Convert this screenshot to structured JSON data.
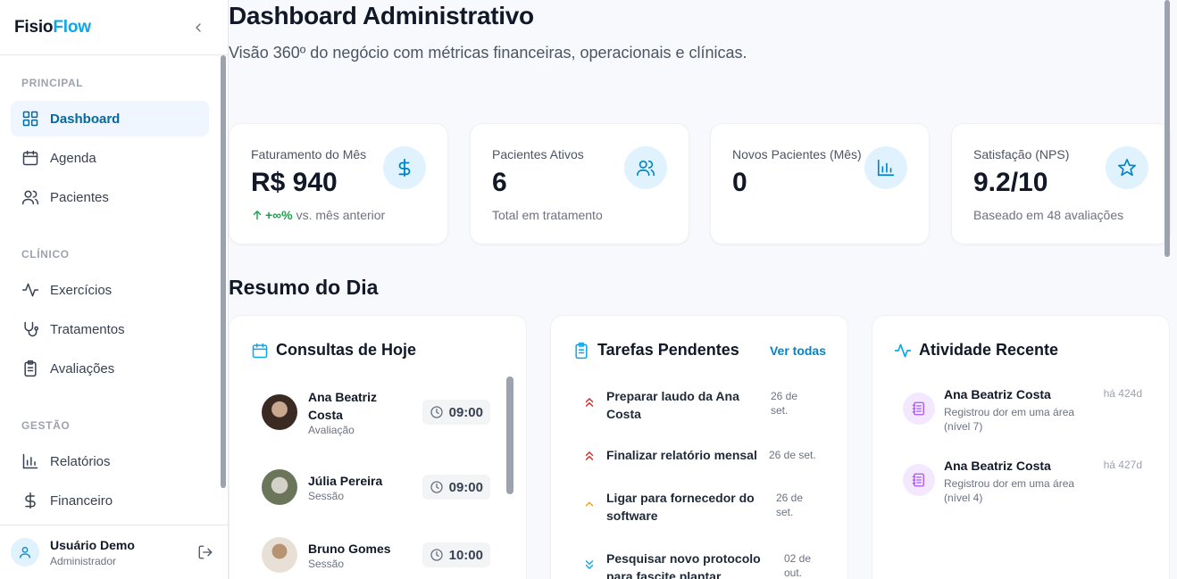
{
  "brand": {
    "part1": "Fisio",
    "part2": "Flow"
  },
  "sidebar": {
    "sections": [
      {
        "title": "PRINCIPAL",
        "items": [
          {
            "label": "Dashboard",
            "icon": "dashboard-grid-icon",
            "active": true
          },
          {
            "label": "Agenda",
            "icon": "calendar-icon"
          },
          {
            "label": "Pacientes",
            "icon": "users-icon"
          }
        ]
      },
      {
        "title": "CLÍNICO",
        "items": [
          {
            "label": "Exercícios",
            "icon": "activity-pulse-icon"
          },
          {
            "label": "Tratamentos",
            "icon": "stethoscope-icon"
          },
          {
            "label": "Avaliações",
            "icon": "clipboard-icon"
          }
        ]
      },
      {
        "title": "GESTÃO",
        "items": [
          {
            "label": "Relatórios",
            "icon": "bar-chart-icon"
          },
          {
            "label": "Financeiro",
            "icon": "dollar-icon"
          }
        ]
      }
    ],
    "user": {
      "name": "Usuário Demo",
      "role": "Administrador"
    }
  },
  "header": {
    "title": "Dashboard Administrativo",
    "subtitle": "Visão 360º do negócio com métricas financeiras, operacionais e clínicas."
  },
  "stats": [
    {
      "label": "Faturamento do Mês",
      "value": "R$ 940",
      "trend": "+∞%",
      "note": "vs. mês anterior",
      "icon": "dollar-icon"
    },
    {
      "label": "Pacientes Ativos",
      "value": "6",
      "note": "Total em tratamento",
      "icon": "users-icon"
    },
    {
      "label": "Novos Pacientes (Mês)",
      "value": "0",
      "note": "",
      "icon": "bar-chart-icon"
    },
    {
      "label": "Satisfação (NPS)",
      "value": "9.2/10",
      "note": "Baseado em 48 avaliações",
      "icon": "star-icon"
    }
  ],
  "summary": {
    "title": "Resumo do Dia",
    "appointments": {
      "title": "Consultas de Hoje",
      "items": [
        {
          "name": "Ana Beatriz Costa",
          "type": "Avaliação",
          "time": "09:00"
        },
        {
          "name": "Júlia Pereira",
          "type": "Sessão",
          "time": "09:00"
        },
        {
          "name": "Bruno Gomes",
          "type": "Sessão",
          "time": "10:00"
        }
      ]
    },
    "tasks": {
      "title": "Tarefas Pendentes",
      "link": "Ver todas",
      "items": [
        {
          "title": "Preparar laudo da Ana Costa",
          "date": "26 de set.",
          "priority": "high"
        },
        {
          "title": "Finalizar relatório mensal",
          "date": "26 de set.",
          "priority": "high"
        },
        {
          "title": "Ligar para fornecedor do software",
          "date": "26 de set.",
          "priority": "medium"
        },
        {
          "title": "Pesquisar novo protocolo para fascite plantar",
          "date": "02 de out.",
          "priority": "low"
        }
      ]
    },
    "activity": {
      "title": "Atividade Recente",
      "items": [
        {
          "name": "Ana Beatriz Costa",
          "desc": "Registrou dor em uma área (nível 7)",
          "time": "há 424d"
        },
        {
          "name": "Ana Beatriz Costa",
          "desc": "Registrou dor em uma área (nível 4)",
          "time": "há 427d"
        }
      ]
    }
  },
  "colors": {
    "accent": "#0ea5e9",
    "active_bg": "#eff6ff",
    "active_text": "#0369a1",
    "trend_up": "#16a34a",
    "priority_high": "#dc2626",
    "priority_medium": "#f59e0b",
    "priority_low": "#0ea5e9",
    "activity_icon": "#a855f7"
  }
}
